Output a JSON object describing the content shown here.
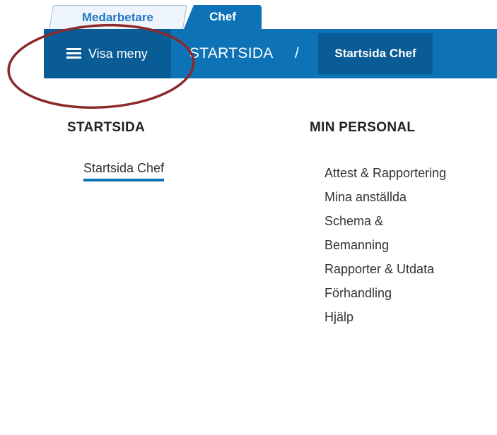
{
  "tabs": [
    {
      "label": "Medarbetare",
      "active": false
    },
    {
      "label": "Chef",
      "active": true
    }
  ],
  "header": {
    "menu_label": "Visa meny",
    "menu_icon": "hamburger-icon",
    "breadcrumb": {
      "root": "STARTSIDA",
      "separator": "/",
      "current": "Startsida Chef"
    }
  },
  "columns": {
    "startsida": {
      "heading": "STARTSIDA",
      "items": [
        "Startsida Chef"
      ]
    },
    "min_personal": {
      "heading": "MIN PERSONAL",
      "items": [
        "Attest & Rapportering",
        "Mina anställda",
        "Schema & Bemanning",
        "Rapporter & Utdata",
        "Förhandling",
        "Hjälp"
      ]
    }
  },
  "colors": {
    "primary": "#0d72b6",
    "primary_dark": "#0a5c96",
    "annotation": "#8b2a2a"
  }
}
